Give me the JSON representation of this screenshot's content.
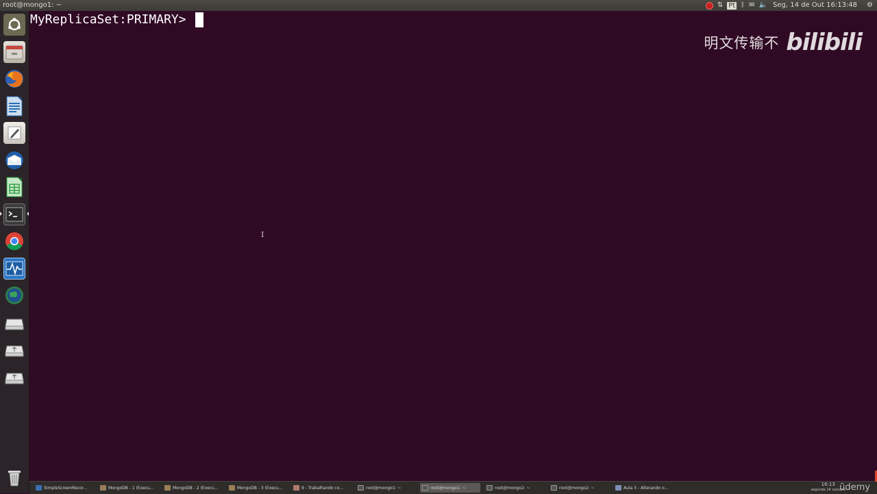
{
  "window": {
    "title": "root@mongo1: ~"
  },
  "tray": {
    "keyboard": "Pt",
    "clock": "Seg, 14 de Out 16:13:48"
  },
  "terminal": {
    "prompt": "MyReplicaSet:PRIMARY> "
  },
  "watermark": {
    "text": "明文传输不",
    "logo": "bilibili"
  },
  "launcher": {
    "items": [
      {
        "name": "ubuntu-dash-icon"
      },
      {
        "name": "files-icon"
      },
      {
        "name": "firefox-icon"
      },
      {
        "name": "libreoffice-writer-icon"
      },
      {
        "name": "text-editor-icon"
      },
      {
        "name": "thunderbird-icon"
      },
      {
        "name": "libreoffice-calc-icon"
      },
      {
        "name": "terminal-icon"
      },
      {
        "name": "chrome-icon"
      },
      {
        "name": "system-monitor-icon"
      },
      {
        "name": "network-globe-icon"
      },
      {
        "name": "drive-icon"
      },
      {
        "name": "usb-drive-icon"
      },
      {
        "name": "usb-drive-icon-2"
      },
      {
        "name": "trash-icon"
      }
    ]
  },
  "taskbar": {
    "tasks": [
      {
        "label": "SimpleScreenRecor...",
        "active": false
      },
      {
        "label": "MongoDB - 1 (Execu...",
        "active": false
      },
      {
        "label": "MongoDB - 2 (Execu...",
        "active": false
      },
      {
        "label": "MongoDB - 3 (Execu...",
        "active": false
      },
      {
        "label": "9 - Trabalhando co...",
        "active": false
      },
      {
        "label": "root@mongo1: ~",
        "active": false
      },
      {
        "label": "root@mongo1: ~",
        "active": true
      },
      {
        "label": "root@mongo2: ~",
        "active": false
      },
      {
        "label": "root@mongo2: ~",
        "active": false
      },
      {
        "label": "Aula 3 - Alterando o...",
        "active": false
      }
    ],
    "clock_time": "16:13",
    "clock_date": "segunda 14 outubro",
    "brand": "ūdemy"
  },
  "colors": {
    "terminal_bg": "#300a24",
    "panel_bg": "#3c3b37",
    "launcher_bg": "#2b2428"
  }
}
